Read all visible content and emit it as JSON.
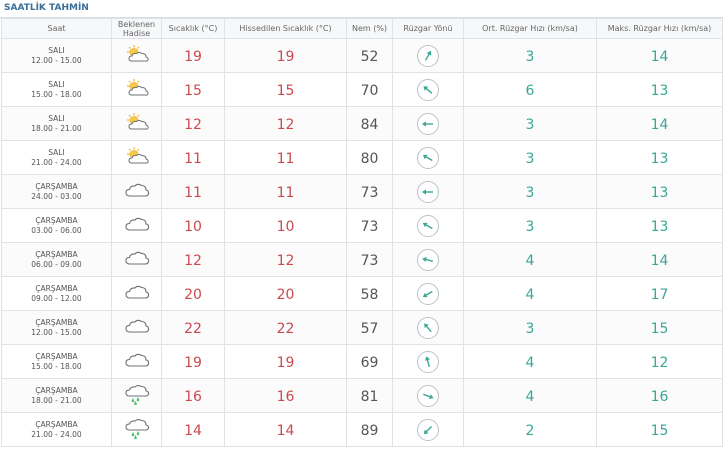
{
  "title": "SAATLİK TAHMİN",
  "headers": {
    "time": "Saat",
    "event": "Beklenen Hadise",
    "temp": "Sıcaklık (°C)",
    "feels": "Hissedilen Sıcaklık (°C)",
    "humidity": "Nem (%)",
    "wind_dir": "Rüzgar Yönü",
    "avg_wind": "Ort. Rüzgar Hızı (km/sa)",
    "max_wind": "Maks. Rüzgar Hızı (km/sa)"
  },
  "rows": [
    {
      "day": "SALI",
      "time": "12.00 - 15.00",
      "icon": "partly-cloudy-icon",
      "temp": "19",
      "feels": "19",
      "humidity": "52",
      "wind_deg": 30,
      "avg": "3",
      "max": "14"
    },
    {
      "day": "SALI",
      "time": "15.00 - 18.00",
      "icon": "partly-cloudy-icon",
      "temp": "15",
      "feels": "15",
      "humidity": "70",
      "wind_deg": -50,
      "avg": "6",
      "max": "13"
    },
    {
      "day": "SALI",
      "time": "18.00 - 21.00",
      "icon": "partly-cloudy-icon",
      "temp": "12",
      "feels": "12",
      "humidity": "84",
      "wind_deg": -90,
      "avg": "3",
      "max": "14"
    },
    {
      "day": "SALI",
      "time": "21.00 - 24.00",
      "icon": "partly-cloudy-icon",
      "temp": "11",
      "feels": "11",
      "humidity": "80",
      "wind_deg": -60,
      "avg": "3",
      "max": "13"
    },
    {
      "day": "ÇARŞAMBA",
      "time": "24.00 - 03.00",
      "icon": "cloud-icon",
      "temp": "11",
      "feels": "11",
      "humidity": "73",
      "wind_deg": -90,
      "avg": "3",
      "max": "13"
    },
    {
      "day": "ÇARŞAMBA",
      "time": "03.00 - 06.00",
      "icon": "cloud-icon",
      "temp": "10",
      "feels": "10",
      "humidity": "73",
      "wind_deg": -60,
      "avg": "3",
      "max": "13"
    },
    {
      "day": "ÇARŞAMBA",
      "time": "06.00 - 09.00",
      "icon": "cloud-icon",
      "temp": "12",
      "feels": "12",
      "humidity": "73",
      "wind_deg": -75,
      "avg": "4",
      "max": "14"
    },
    {
      "day": "ÇARŞAMBA",
      "time": "09.00 - 12.00",
      "icon": "cloud-icon",
      "temp": "20",
      "feels": "20",
      "humidity": "58",
      "wind_deg": -120,
      "avg": "4",
      "max": "17"
    },
    {
      "day": "ÇARŞAMBA",
      "time": "12.00 - 15.00",
      "icon": "cloud-icon",
      "temp": "22",
      "feels": "22",
      "humidity": "57",
      "wind_deg": -40,
      "avg": "3",
      "max": "15"
    },
    {
      "day": "ÇARŞAMBA",
      "time": "15.00 - 18.00",
      "icon": "cloud-icon",
      "temp": "19",
      "feels": "19",
      "humidity": "69",
      "wind_deg": -15,
      "avg": "4",
      "max": "12"
    },
    {
      "day": "ÇARŞAMBA",
      "time": "18.00 - 21.00",
      "icon": "rain-cloud-icon",
      "temp": "16",
      "feels": "16",
      "humidity": "81",
      "wind_deg": 110,
      "avg": "4",
      "max": "16"
    },
    {
      "day": "ÇARŞAMBA",
      "time": "21.00 - 24.00",
      "icon": "rain-cloud-icon",
      "temp": "14",
      "feels": "14",
      "humidity": "89",
      "wind_deg": -135,
      "avg": "2",
      "max": "15"
    }
  ]
}
